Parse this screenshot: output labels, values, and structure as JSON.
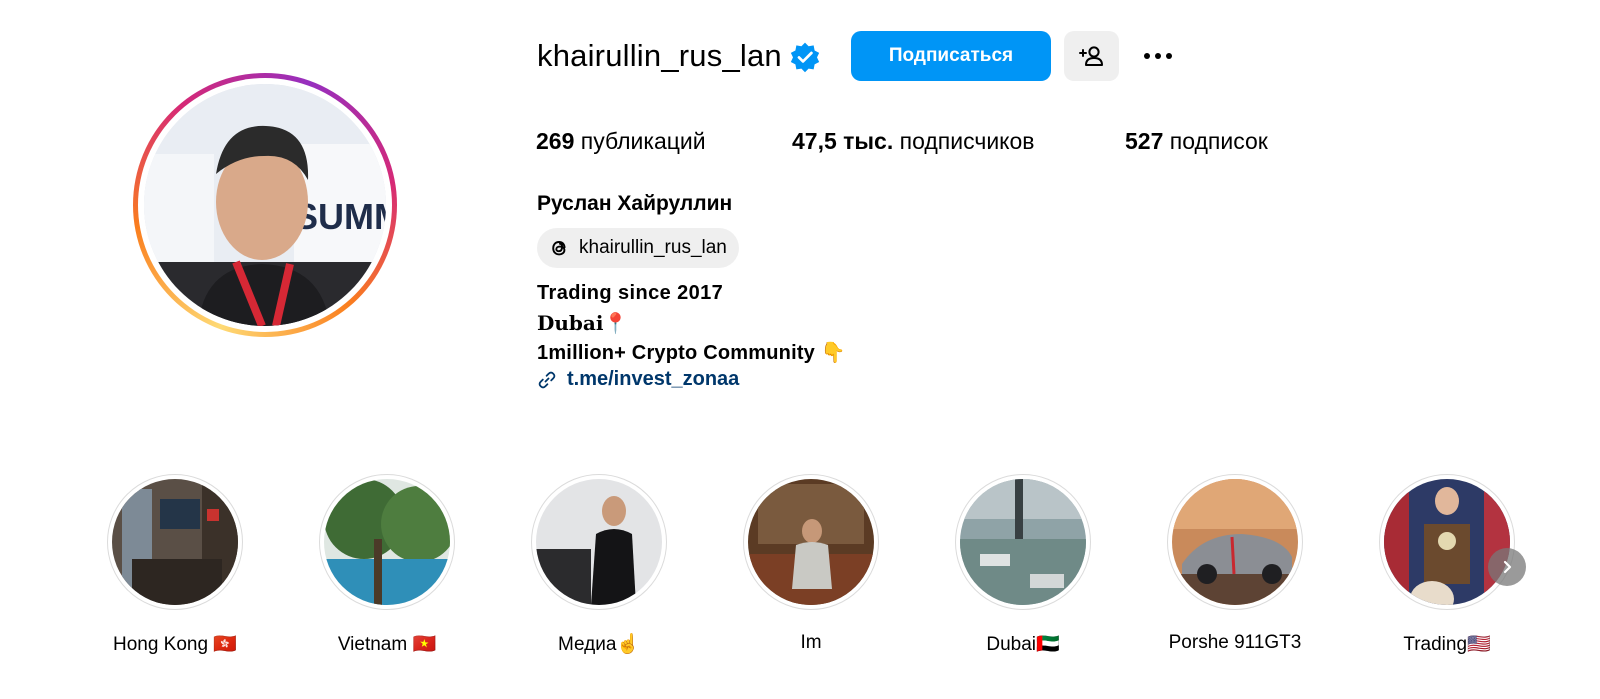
{
  "profile": {
    "username": "khairullin_rus_lan",
    "verified": true,
    "follow_label": "Подписаться",
    "full_name": "Руслан Хайруллин",
    "threads_handle": "khairullin_rus_lan"
  },
  "stats": {
    "posts_count": "269",
    "posts_label": "публикаций",
    "followers_count": "47,5 тыс.",
    "followers_label": "подписчиков",
    "following_count": "527",
    "following_label": "подписок"
  },
  "bio": {
    "line1": "Trading since 2017",
    "line2": "Dubai📍",
    "line3": "1million+ Crypto Community 👇",
    "link": "t.me/invest_zonaa"
  },
  "highlights": [
    {
      "label": "Hong Kong 🇭🇰"
    },
    {
      "label": "Vietnam 🇻🇳"
    },
    {
      "label": "Медиа☝️"
    },
    {
      "label": "Im"
    },
    {
      "label": "Dubai🇦🇪"
    },
    {
      "label": "Porshe 911GT3"
    },
    {
      "label": "Trading🇺🇸"
    }
  ],
  "colors": {
    "accent": "#0095f6",
    "verified": "#0095f6",
    "link": "#00376b",
    "secondary_bg": "#efefef"
  },
  "icons": {
    "verified": "verified-badge-icon",
    "suggest": "add-person-icon",
    "more": "more-options-icon",
    "threads": "threads-icon",
    "link": "link-icon",
    "next": "chevron-right-icon"
  }
}
